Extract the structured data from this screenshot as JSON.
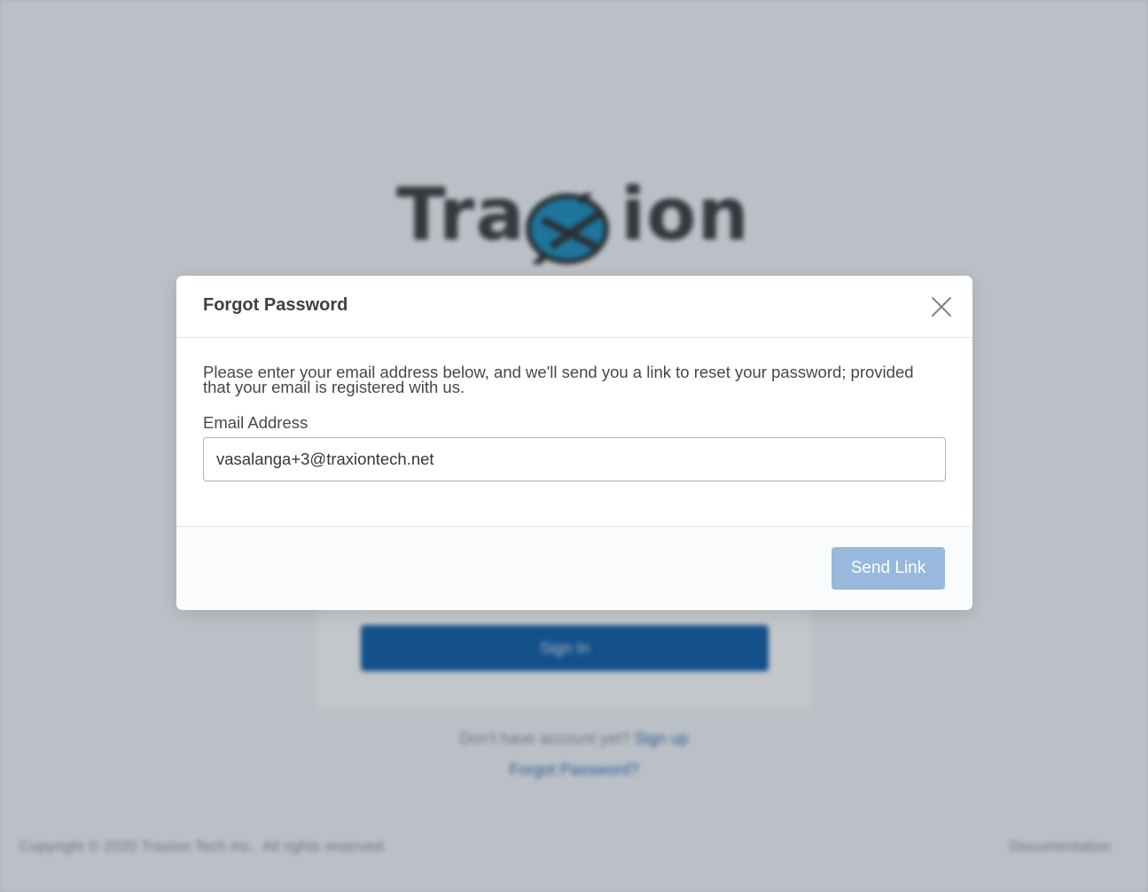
{
  "background": {
    "logo": {
      "text_left": "Tra",
      "text_right": "ion"
    },
    "signin_label": "Sign In",
    "signup_prompt": "Don't have account yet?",
    "signup_link": "Sign up",
    "forgot_link": "Forgot Password?",
    "copyright": "Copyright © 2020 Traxion Tech Inc.. All rights reserved.",
    "documentation_link": "Documentation"
  },
  "modal": {
    "title": "Forgot Password",
    "description": "Please enter your email address below, and we'll send you a link to reset your password; provided that your email is registered with us.",
    "email_label": "Email Address",
    "email_value": "vasalanga+3@traxiontech.net",
    "send_label": "Send Link"
  },
  "colors": {
    "primary": "#0c5aa6",
    "send_button_disabled": "#98b9dc",
    "logo_globe": "#1b8fc0",
    "text": "#43484d"
  }
}
